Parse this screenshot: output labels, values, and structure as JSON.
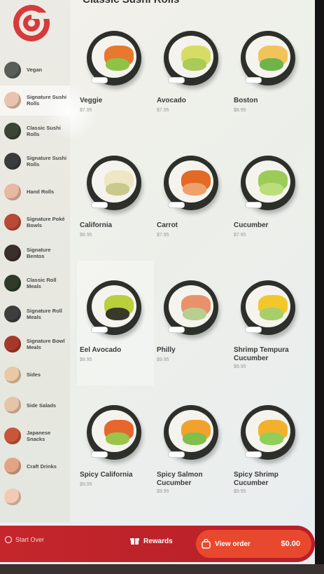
{
  "section": {
    "title": "Classic Sushi Rolls"
  },
  "categories": [
    {
      "label": "Vegan",
      "color": "#5a5e58"
    },
    {
      "label": "Signature Sushi Rolls",
      "color": "#e8c3ae"
    },
    {
      "label": "Classic Sushi Rolls",
      "color": "#3c4436"
    },
    {
      "label": "Signature Sushi Rolls",
      "color": "#3b3d3c"
    },
    {
      "label": "Hand Rolls",
      "color": "#e7b8a2"
    },
    {
      "label": "Signature Poké Bowls",
      "color": "#b84a36"
    },
    {
      "label": "Signature Bentos",
      "color": "#3a2f2a"
    },
    {
      "label": "Classic Roll Meals",
      "color": "#2f3a28"
    },
    {
      "label": "Signature Roll Meals",
      "color": "#3e3e3e"
    },
    {
      "label": "Signature Bowl Meals",
      "color": "#a63a2a"
    },
    {
      "label": "Sides",
      "color": "#e9c8a6"
    },
    {
      "label": "Side Salads",
      "color": "#e6c4a8"
    },
    {
      "label": "Japanese Snacks",
      "color": "#c9553a"
    },
    {
      "label": "Craft Drinks",
      "color": "#e2a584"
    },
    {
      "label": "",
      "color": "#f1c9b4"
    }
  ],
  "items": [
    {
      "name": "Veggie",
      "price": "$7.95",
      "fill": "#e8782e",
      "fill2": "#8fc346"
    },
    {
      "name": "Avocado",
      "price": "$7.95",
      "fill": "#d7dd63",
      "fill2": "#aacb58"
    },
    {
      "name": "Boston",
      "price": "$8.95",
      "fill": "#f1c45a",
      "fill2": "#6fb44a"
    },
    {
      "name": "California",
      "price": "$8.95",
      "fill": "#eee6c4",
      "fill2": "#c8c98a"
    },
    {
      "name": "Carrot",
      "price": "$7.95",
      "fill": "#e26a24",
      "fill2": "#f0a06a"
    },
    {
      "name": "Cucumber",
      "price": "$7.95",
      "fill": "#9ccc58",
      "fill2": "#b9de7a"
    },
    {
      "name": "Eel Avocado",
      "price": "$9.95",
      "fill": "#b9cf3b",
      "fill2": "#3a3a2a"
    },
    {
      "name": "Philly",
      "price": "$9.95",
      "fill": "#e8916a",
      "fill2": "#b6cf8e"
    },
    {
      "name": "Shrimp Tempura Cucumber",
      "price": "$9.95",
      "fill": "#f2c72c",
      "fill2": "#a6cf6a"
    },
    {
      "name": "Spicy California",
      "price": "$9.95",
      "fill": "#e6662e",
      "fill2": "#9bc54a"
    },
    {
      "name": "Spicy Salmon Cucumber",
      "price": "$9.95",
      "fill": "#f2a22c",
      "fill2": "#7fbf4a"
    },
    {
      "name": "Spicy Shrimp Cucumber",
      "price": "$9.95",
      "fill": "#f3b02c",
      "fill2": "#8fcf5a"
    }
  ],
  "bottom": {
    "left_label": "Start Over",
    "rewards_label": "Rewards",
    "order_label": "View order",
    "total": "$0.00"
  },
  "colors": {
    "brand_red": "#c4262b",
    "accent_orange": "#e8492e"
  }
}
